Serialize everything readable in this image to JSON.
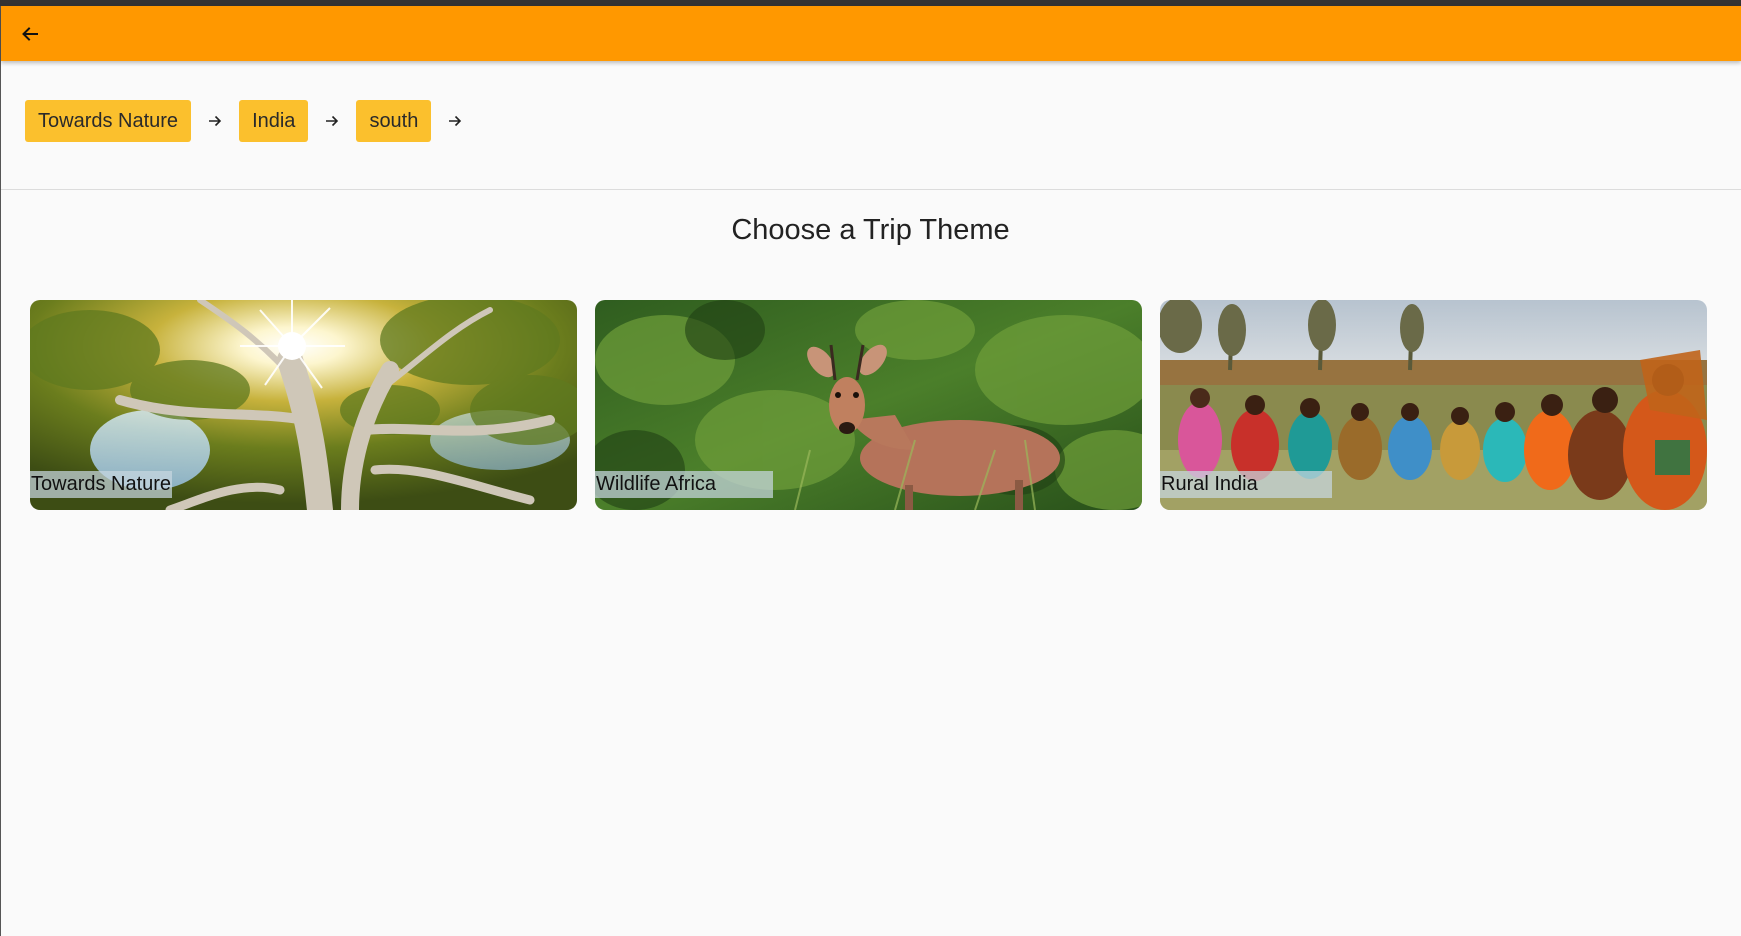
{
  "appbar": {
    "back_icon": "arrow-left-icon",
    "color": "#ff9800"
  },
  "breadcrumbs": {
    "items": [
      {
        "label": "Towards Nature"
      },
      {
        "label": "India"
      },
      {
        "label": "south"
      }
    ],
    "separator_icon": "arrow-right-icon",
    "chip_color": "#fbc02d"
  },
  "main": {
    "title": "Choose a Trip Theme",
    "themes": [
      {
        "label": "Towards Nature",
        "image": "sunlit-tree-canopy"
      },
      {
        "label": "Wildlife Africa",
        "image": "impala-in-bush"
      },
      {
        "label": "Rural India",
        "image": "village-women-in-field"
      }
    ]
  }
}
